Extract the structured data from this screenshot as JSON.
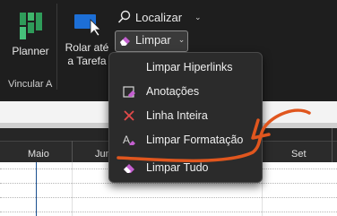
{
  "ribbon": {
    "planner_label": "Planner",
    "rolar_label_line1": "Rolar até",
    "rolar_label_line2": "a Tarefa",
    "localizar_label": "Localizar",
    "limpar_label": "Limpar",
    "group_label": "Vincular A"
  },
  "timeline": {
    "months": [
      "Maio",
      "Jun",
      "Set"
    ]
  },
  "menu": {
    "items": [
      {
        "label": "Limpar Hiperlinks",
        "icon": "none"
      },
      {
        "label": "Anotações",
        "icon": "note-eraser-icon"
      },
      {
        "label": "Linha Inteira",
        "icon": "red-x-icon"
      },
      {
        "label": "Limpar Formatação",
        "icon": "clear-format-icon"
      },
      {
        "label": "Limpar Tudo",
        "icon": "eraser-icon"
      }
    ]
  },
  "colors": {
    "accent": "#e0561e",
    "menu_bg": "#2b2b2b",
    "ribbon_bg": "#1e1e1e"
  }
}
